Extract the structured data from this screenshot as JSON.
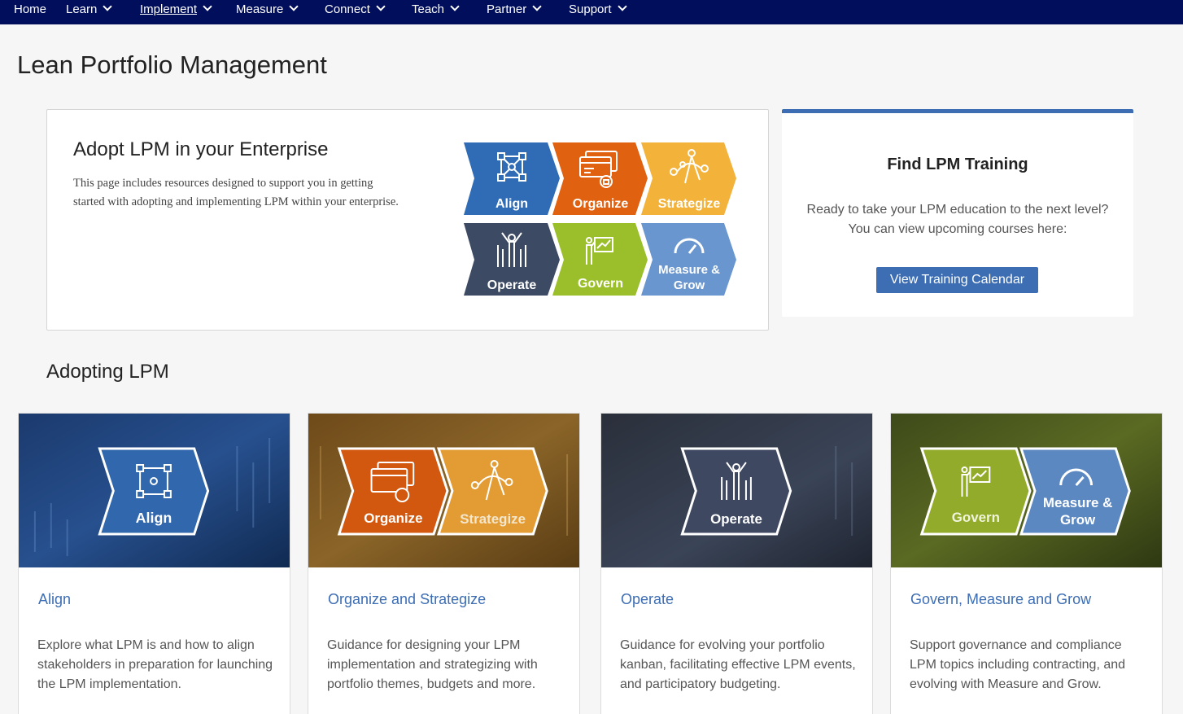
{
  "nav": {
    "items": [
      {
        "label": "Home",
        "dropdown": false
      },
      {
        "label": "Learn",
        "dropdown": true
      },
      {
        "label": "Implement",
        "dropdown": true,
        "active": true
      },
      {
        "label": "Measure",
        "dropdown": true
      },
      {
        "label": "Connect",
        "dropdown": true
      },
      {
        "label": "Teach",
        "dropdown": true
      },
      {
        "label": "Partner",
        "dropdown": true
      },
      {
        "label": "Support",
        "dropdown": true
      }
    ]
  },
  "page_title": "Lean Portfolio Management",
  "adopt": {
    "heading": "Adopt LPM in your Enterprise",
    "body": "This page includes resources designed to support you in getting started with adopting and implementing LPM within your enterprise.",
    "chevrons": [
      {
        "label": "Align",
        "color": "#2f6cb5",
        "icon": "network-icon"
      },
      {
        "label": "Organize",
        "color": "#e0610f",
        "icon": "cards-lock-icon"
      },
      {
        "label": "Strategize",
        "color": "#f3b23a",
        "icon": "compass-icon"
      },
      {
        "label": "Operate",
        "color": "#3d4a63",
        "icon": "team-icon"
      },
      {
        "label": "Govern",
        "color": "#9bbf2a",
        "icon": "presenter-icon"
      },
      {
        "label": "Measure &",
        "label2": "Grow",
        "color": "#6a96cf",
        "icon": "gauge-icon"
      }
    ]
  },
  "training": {
    "heading": "Find LPM Training",
    "line1": "Ready to take your LPM education to the next level?",
    "line2": "You can view upcoming courses here:",
    "button": "View Training Calendar",
    "accent": "#3d6db3"
  },
  "section_title": "Adopting LPM",
  "cards": [
    {
      "title": "Align",
      "description": "Explore what LPM is and how to align stakeholders in preparation for launching the LPM implementation.",
      "chevrons": [
        "Align"
      ]
    },
    {
      "title": "Organize and Strategize",
      "description": "Guidance for designing your LPM implementation and strategizing with portfolio themes, budgets and more.",
      "chevrons": [
        "Organize",
        "Strategize"
      ]
    },
    {
      "title": "Operate",
      "description": "Guidance for evolving your portfolio kanban, facilitating effective LPM events, and participatory budgeting.",
      "chevrons": [
        "Operate"
      ]
    },
    {
      "title": "Govern, Measure and Grow",
      "description": "Support governance and compliance LPM topics including contracting, and evolving with Measure and Grow.",
      "chevrons": [
        "Govern",
        "Measure &",
        "Grow"
      ]
    }
  ]
}
